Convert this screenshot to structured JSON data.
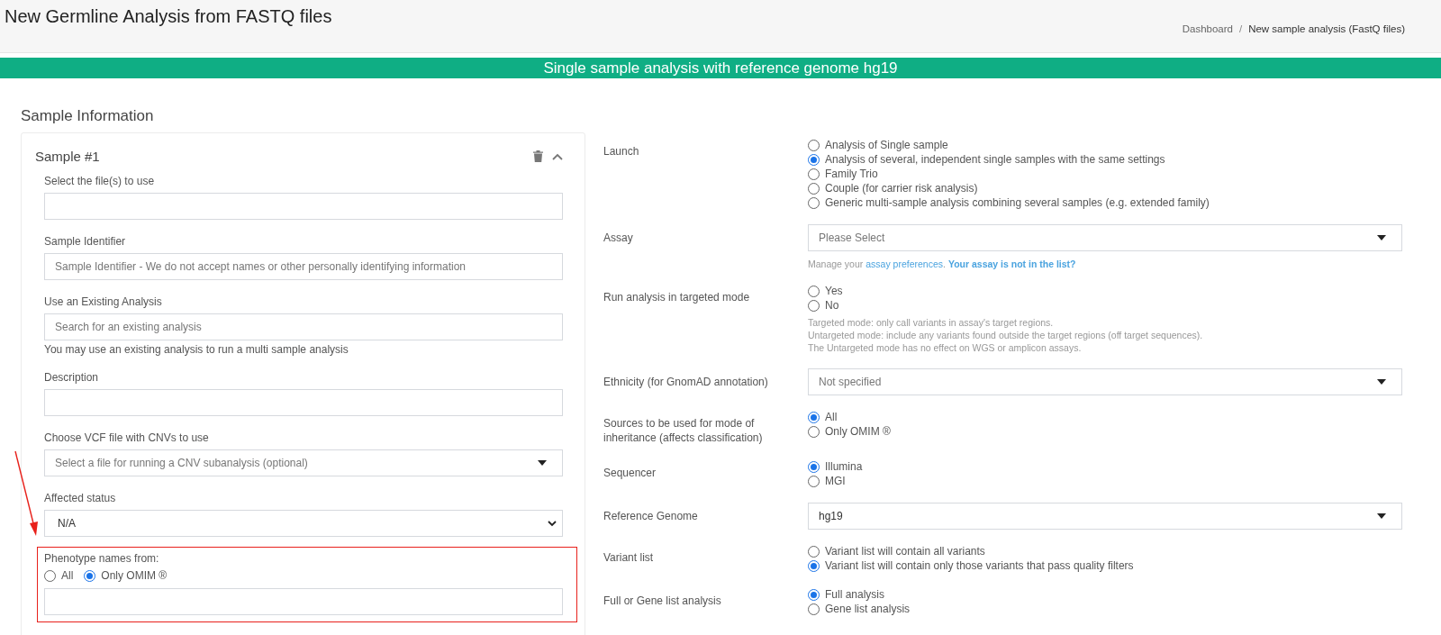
{
  "header": {
    "title": "New Germline Analysis from FASTQ files",
    "breadcrumb": {
      "items": [
        "Dashboard",
        "New sample analysis (FastQ files)"
      ],
      "separator": "/"
    }
  },
  "banner": "Single sample analysis with reference genome hg19",
  "section_title": "Sample Information",
  "sample": {
    "title": "Sample #1",
    "fields": [
      {
        "kind": "input",
        "label": "Select the file(s) to use"
      },
      {
        "kind": "input",
        "label": "Sample Identifier",
        "placeholder": "Sample Identifier - We do not accept names or other personally identifying information"
      },
      {
        "kind": "input",
        "label": "Use an Existing Analysis",
        "placeholder": "Search for an existing analysis",
        "help": "You may use an existing analysis to run a multi sample analysis"
      },
      {
        "kind": "input",
        "label": "Description"
      },
      {
        "kind": "dropdown",
        "label": "Choose VCF file with CNVs to use",
        "placeholder": "Select a file for running a CNV subanalysis (optional)"
      },
      {
        "kind": "native_select",
        "label": "Affected status",
        "value": "N/A"
      },
      {
        "kind": "radio_input",
        "label": "Phenotype names from:",
        "highlighted": true,
        "options": [
          {
            "label": "All",
            "selected": false
          },
          {
            "label": "Only OMIM ®",
            "selected": true
          }
        ]
      }
    ]
  },
  "settings": [
    {
      "kind": "radio",
      "label": "Launch",
      "options": [
        {
          "label": "Analysis of Single sample",
          "selected": false
        },
        {
          "label": "Analysis of several, independent single samples with the same settings",
          "selected": true
        },
        {
          "label": "Family Trio",
          "selected": false
        },
        {
          "label": "Couple (for carrier risk analysis)",
          "selected": false
        },
        {
          "label": "Generic multi-sample analysis combining several samples (e.g. extended family)",
          "selected": false
        }
      ]
    },
    {
      "kind": "select",
      "label": "Assay",
      "placeholder": "Please Select",
      "help": [
        {
          "kind": "text",
          "text": "Manage your "
        },
        {
          "kind": "link",
          "text": "assay preferences"
        },
        {
          "kind": "text",
          "text": "."
        },
        {
          "kind": "strong_link",
          "text": "Your assay is not in the list?"
        }
      ]
    },
    {
      "kind": "radio",
      "label": "Run analysis in targeted mode",
      "options": [
        {
          "label": "Yes",
          "selected": false
        },
        {
          "label": "No",
          "selected": false
        }
      ],
      "notes": [
        "Targeted mode: only call variants in assay's target regions.",
        "Untargeted mode: include any variants found outside the target regions (off target sequences).",
        "The Untargeted mode has no effect on WGS or amplicon assays."
      ]
    },
    {
      "kind": "select",
      "label": "Ethnicity (for GnomAD annotation)",
      "placeholder": "Not specified"
    },
    {
      "kind": "radio",
      "label": "Sources to be used for mode of inheritance (affects classification)",
      "options": [
        {
          "label": "All",
          "selected": true
        },
        {
          "label": "Only OMIM ®",
          "selected": false
        }
      ]
    },
    {
      "kind": "radio",
      "label": "Sequencer",
      "options": [
        {
          "label": "Illumina",
          "selected": true
        },
        {
          "label": "MGI",
          "selected": false
        }
      ]
    },
    {
      "kind": "select",
      "label": "Reference Genome",
      "value": "hg19"
    },
    {
      "kind": "radio",
      "label": "Variant list",
      "options": [
        {
          "label": "Variant list will contain all variants",
          "selected": false
        },
        {
          "label": "Variant list will contain only those variants that pass quality filters",
          "selected": true
        }
      ]
    },
    {
      "kind": "radio",
      "label": "Full or Gene list analysis",
      "options": [
        {
          "label": "Full analysis",
          "selected": true
        },
        {
          "label": "Gene list analysis",
          "selected": false
        }
      ]
    }
  ]
}
